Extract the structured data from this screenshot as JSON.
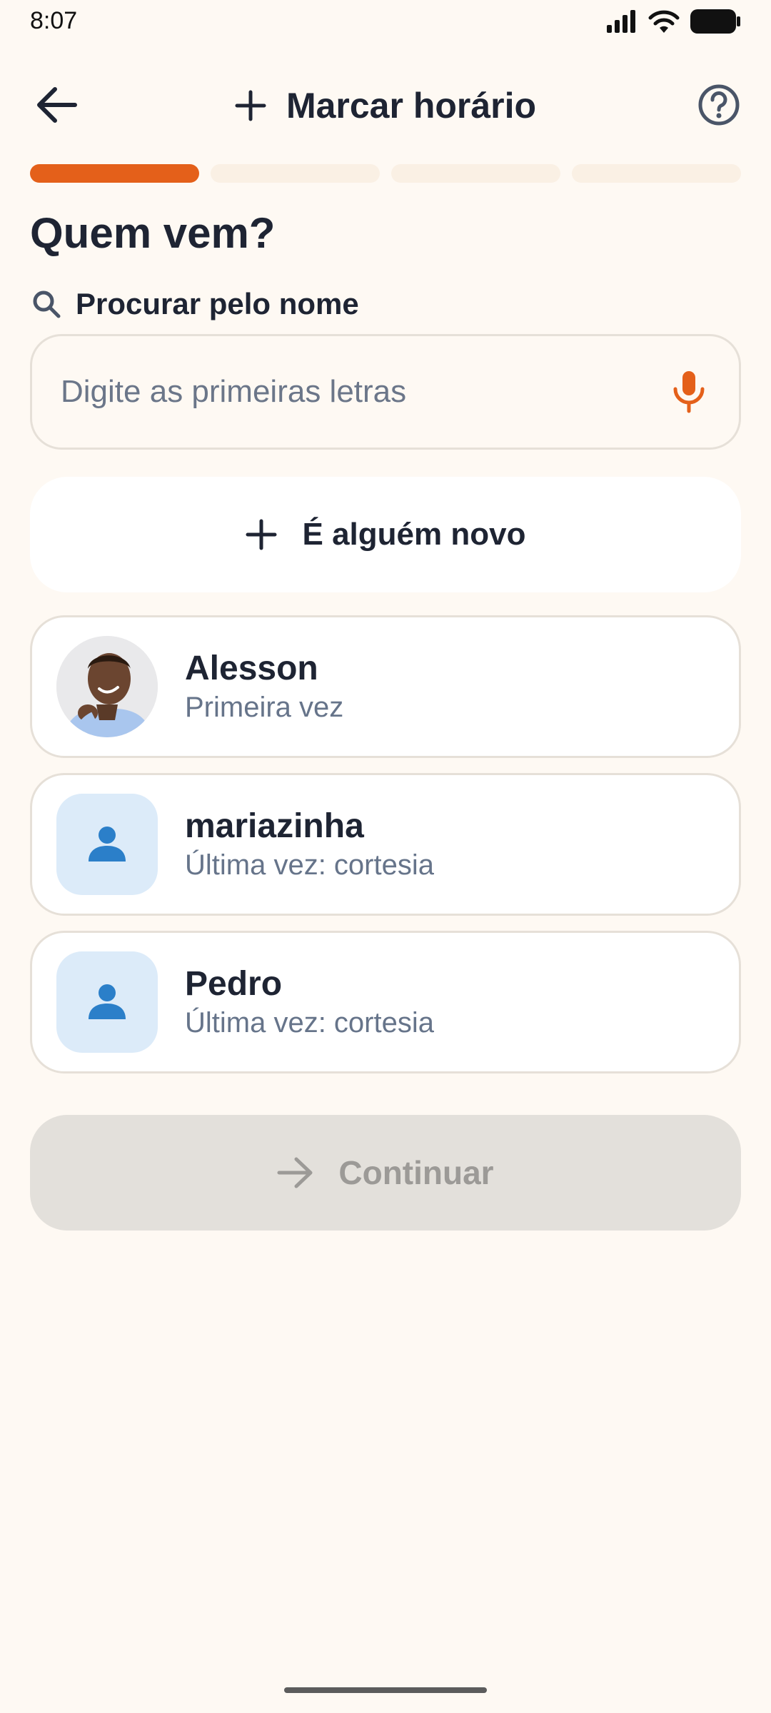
{
  "status_bar": {
    "time": "8:07",
    "icons": [
      "signal-icon",
      "wifi-icon",
      "battery-icon"
    ]
  },
  "header": {
    "back_icon": "arrow-left-icon",
    "title_icon": "plus-icon",
    "title": "Marcar horário",
    "help_icon": "help-circle-icon"
  },
  "progress": {
    "total_steps": 4,
    "current_step": 1,
    "active_color": "#E4601A",
    "inactive_color": "#FAF0E4"
  },
  "section": {
    "title": "Quem vem?"
  },
  "search": {
    "label": "Procurar pelo nome",
    "placeholder": "Digite as primeiras letras",
    "value": "",
    "mic_color": "#E4601A"
  },
  "new_client": {
    "label": "É alguém novo"
  },
  "clients": [
    {
      "name": "Alesson",
      "subtitle": "Primeira vez",
      "avatar": "photo"
    },
    {
      "name": "mariazinha",
      "subtitle": "Última vez: cortesia",
      "avatar": "person-icon"
    },
    {
      "name": "Pedro",
      "subtitle": "Última vez: cortesia",
      "avatar": "person-icon"
    }
  ],
  "continue_button": {
    "label": "Continuar",
    "enabled": false
  },
  "colors": {
    "background": "#FEF9F3",
    "accent": "#E4601A",
    "text": "#1E2433",
    "muted_text": "#66748A",
    "avatar_bg": "#DCEBF9",
    "avatar_icon": "#2B7FC9"
  }
}
